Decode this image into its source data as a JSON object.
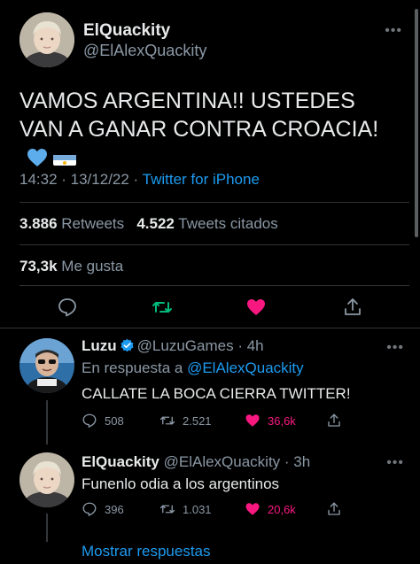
{
  "main_tweet": {
    "author_name": "ElQuackity",
    "author_handle": "@ElAlexQuackity",
    "text": "VAMOS ARGENTINA!! USTEDES VAN A GANAR CONTRA CROACIA!",
    "emoji": [
      "blue-heart",
      "argentina-flag"
    ],
    "time": "14:32 · 13/12/22 · ",
    "source": "Twitter for iPhone",
    "retweets_count": "3.886",
    "retweets_label": "Retweets",
    "quotes_count": "4.522",
    "quotes_label": "Tweets citados",
    "likes_count": "73,3k",
    "likes_label": "Me gusta",
    "liked": true,
    "colors": {
      "like": "#f91880",
      "retweet": "#00ba7c",
      "link": "#1d9bf0"
    }
  },
  "replies": [
    {
      "name": "Luzu",
      "verified": true,
      "handle": "@LuzuGames",
      "time": "· 4h",
      "reply_prefix": "En respuesta a ",
      "reply_mention": "@ElAlexQuackity",
      "text": "CALLATE LA BOCA CIERRA TWITTER!",
      "replies_count": "508",
      "retweets_count": "2.521",
      "likes_count": "36,6k"
    },
    {
      "name": "ElQuackity",
      "verified": false,
      "handle": "@ElAlexQuackity",
      "time": "· 3h",
      "text": "Funenlo odia a los argentinos",
      "replies_count": "396",
      "retweets_count": "1.031",
      "likes_count": "20,6k"
    }
  ],
  "show_replies_label": "Mostrar respuestas",
  "icons": {
    "more": "more-dots-icon",
    "reply": "reply-bubble-icon",
    "retweet": "retweet-icon",
    "like": "heart-icon",
    "share": "share-icon",
    "verified": "verified-badge-icon"
  }
}
